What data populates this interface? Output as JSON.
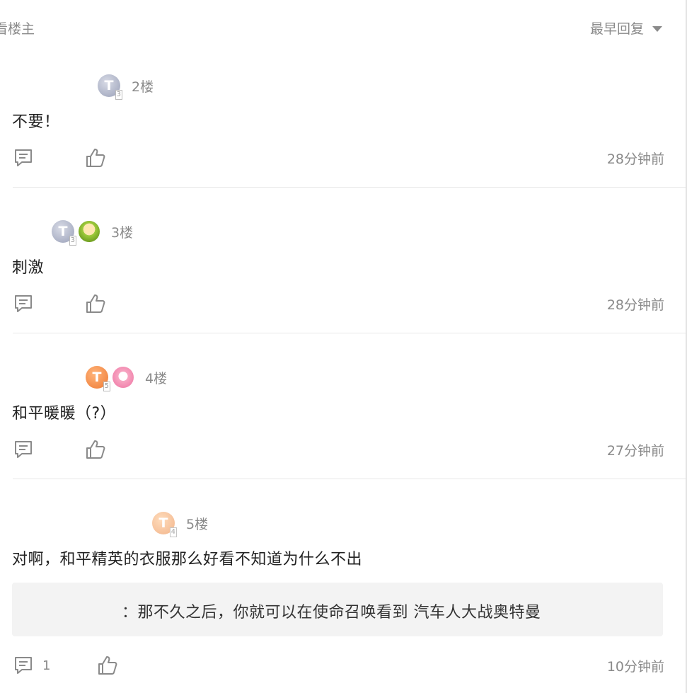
{
  "header": {
    "only_op_label": "看楼主",
    "sort_label": "最早回复"
  },
  "posts": [
    {
      "floor": "2楼",
      "content": "不要！",
      "time": "28分钟前",
      "badges": [
        "silver-T3"
      ]
    },
    {
      "floor": "3楼",
      "content": "刺激",
      "time": "28分钟前",
      "badges": [
        "silver-T3",
        "green-avatar"
      ]
    },
    {
      "floor": "4楼",
      "content": "和平暖暖（?）",
      "time": "27分钟前",
      "badges": [
        "orange-T5",
        "pink-avatar"
      ]
    },
    {
      "floor": "5楼",
      "content": "对啊，和平精英的衣服那么好看不知道为什么不出",
      "quote": "：那不久之后，你就可以在使命召唤看到  汽车人大战奥特曼",
      "reply_count": "1",
      "time": "10分钟前",
      "badges": [
        "peach-T4"
      ]
    }
  ],
  "colors": {
    "text_primary": "#222222",
    "text_secondary": "#8a8a8a",
    "divider": "#e8e8e8",
    "quote_bg": "#f3f3f3"
  },
  "icons": [
    "comment-icon",
    "thumbs-up-icon",
    "caret-down-icon"
  ]
}
